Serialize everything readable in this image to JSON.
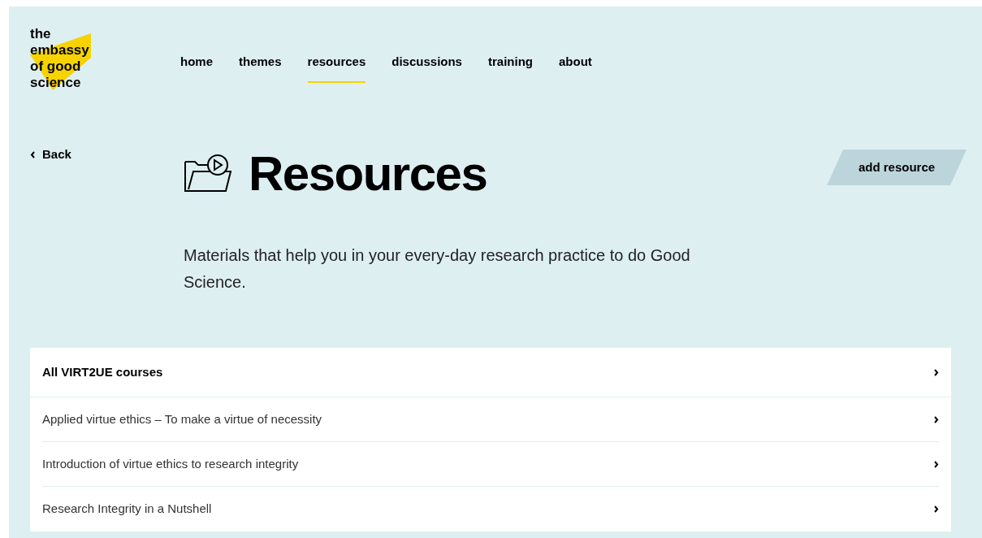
{
  "logo": {
    "lines": [
      "the",
      "embassy",
      "of good",
      "science"
    ]
  },
  "nav": [
    {
      "label": "home",
      "selected": false
    },
    {
      "label": "themes",
      "selected": false
    },
    {
      "label": "resources",
      "selected": true
    },
    {
      "label": "discussions",
      "selected": false
    },
    {
      "label": "training",
      "selected": false
    },
    {
      "label": "about",
      "selected": false
    }
  ],
  "back": {
    "label": "Back"
  },
  "title": "Resources",
  "description": "Materials that help you in your every-day research practice to do Good Science.",
  "add_button": "add resource",
  "list": [
    {
      "kind": "header",
      "label": "All VIRT2UE courses"
    },
    {
      "kind": "item",
      "label": "Applied virtue ethics – To make a virtue of necessity"
    },
    {
      "kind": "item",
      "label": "Introduction of virtue ethics to research integrity"
    },
    {
      "kind": "item",
      "label": "Research Integrity in a Nutshell"
    }
  ]
}
